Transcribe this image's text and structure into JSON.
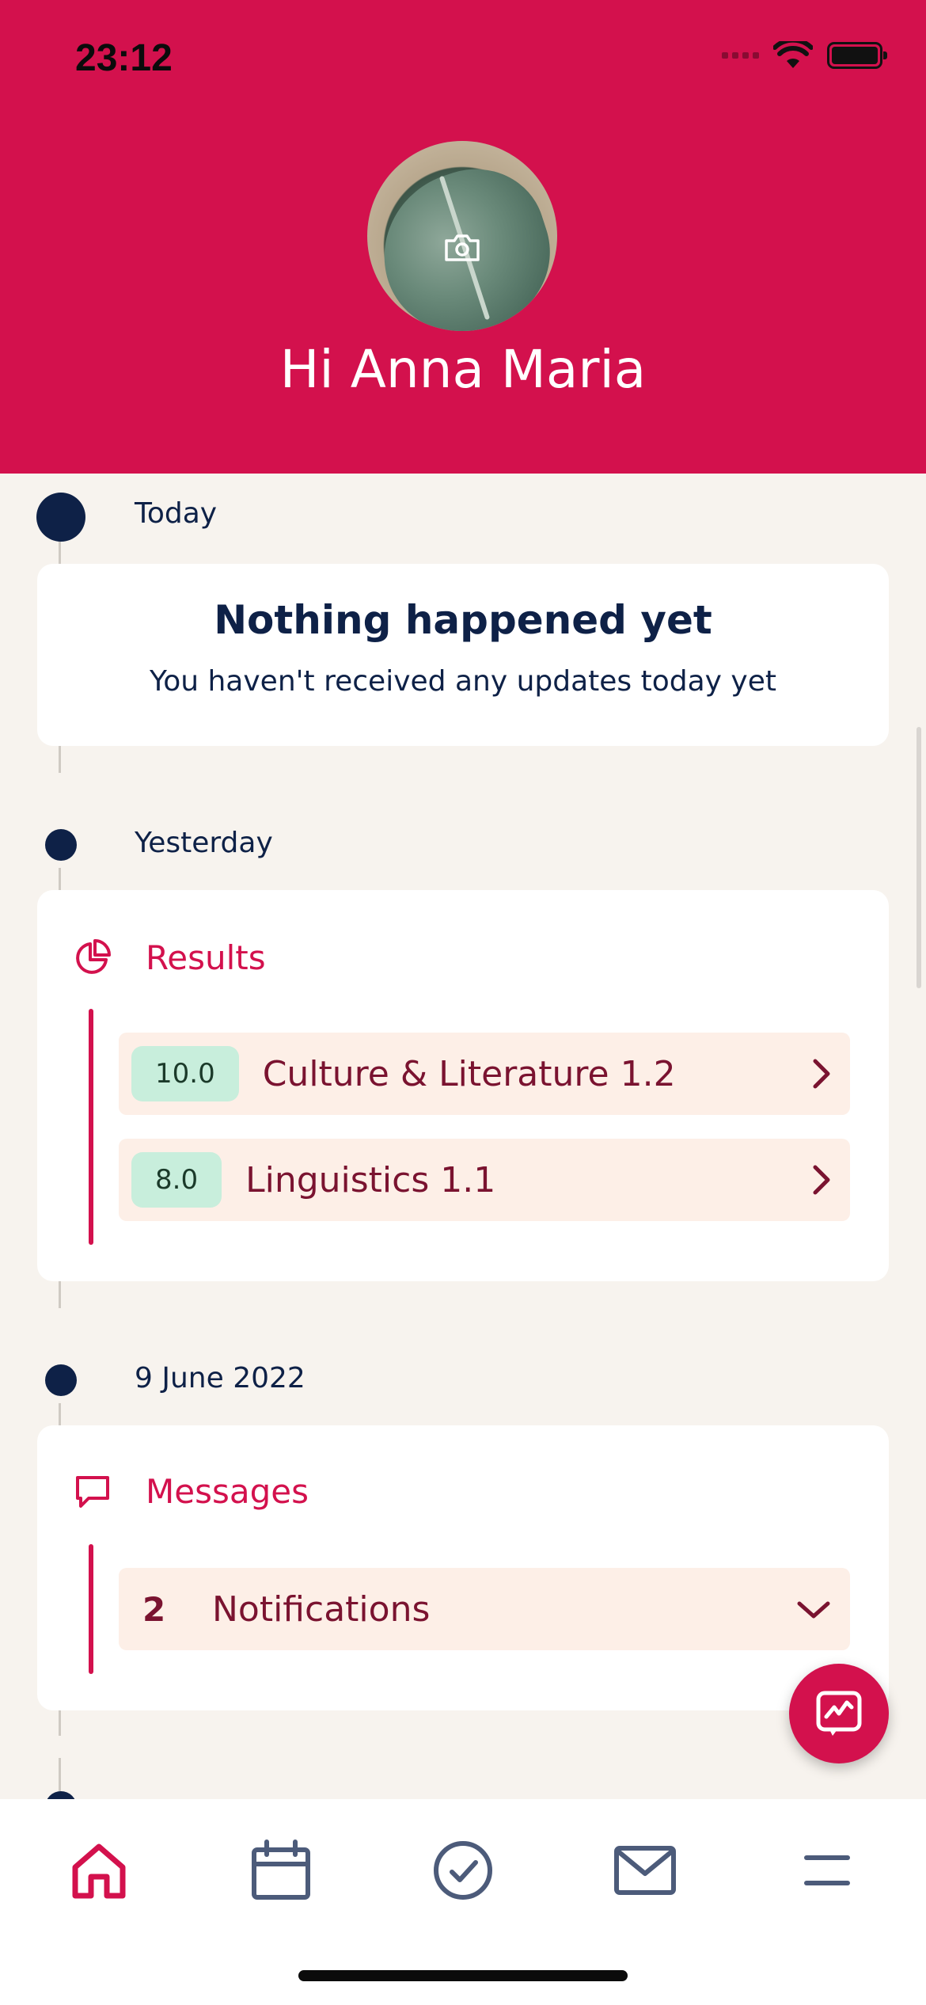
{
  "status_bar": {
    "time": "23:12"
  },
  "header": {
    "greeting": "Hi Anna Maria"
  },
  "timeline": {
    "today": {
      "label": "Today",
      "card_title": "Nothing happened yet",
      "card_subtitle": "You haven't received any updates today yet"
    },
    "yesterday": {
      "label": "Yesterday",
      "section_title": "Results",
      "results": [
        {
          "grade": "10.0",
          "course": "Culture & Literature 1.2"
        },
        {
          "grade": "8.0",
          "course": "Linguistics 1.1"
        }
      ]
    },
    "june": {
      "label": "9 June 2022",
      "section_title": "Messages",
      "notifications_count": "2",
      "notifications_label": "Notifications"
    }
  },
  "tabbar": {
    "tabs": [
      {
        "icon": "home-icon",
        "active": true
      },
      {
        "icon": "calendar-icon",
        "active": false
      },
      {
        "icon": "check-circle-icon",
        "active": false
      },
      {
        "icon": "mail-icon",
        "active": false
      },
      {
        "icon": "menu-icon",
        "active": false
      }
    ]
  },
  "colors": {
    "brand": "#D3114D",
    "navy": "#0E2147",
    "background": "#F7F3EE",
    "row": "#FDEFE7",
    "badge": "#C8EEDC"
  }
}
